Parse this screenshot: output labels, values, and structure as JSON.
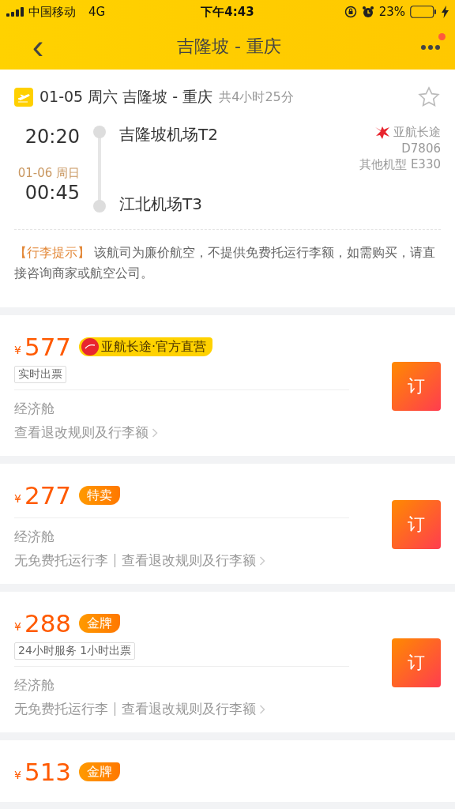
{
  "status_bar": {
    "carrier": "中国移动",
    "network": "4G",
    "time": "下午4:43",
    "battery": "23%"
  },
  "nav": {
    "back": "‹",
    "title": "吉隆坡 - 重庆",
    "notification": true
  },
  "flight": {
    "date_route": "01-05 周六 吉隆坡 - 重庆",
    "duration": "共4小时25分",
    "favorite": false,
    "depart": {
      "time": "20:20",
      "airport": "吉隆坡机场T2"
    },
    "arrive": {
      "date": "01-06 周日",
      "time": "00:45",
      "airport": "江北机场T3"
    },
    "airline": "亚航长途",
    "flight_no": "D7806",
    "aircraft": "其他机型 E330",
    "notice": {
      "label": "【行李提示】",
      "text": "该航司为廉价航空，不提供免费托运行李额，如需购买，请直接咨询商家或航空公司。"
    }
  },
  "fares": [
    {
      "currency": "¥",
      "price": "577",
      "badge": {
        "kind": "airline",
        "text": "亚航长途·官方直营"
      },
      "tag": "实时出票",
      "cabin": "经济舱",
      "rules": "查看退改规则及行李额",
      "book": "订"
    },
    {
      "currency": "¥",
      "price": "277",
      "badge": {
        "kind": "promo",
        "text": "特卖"
      },
      "cabin": "经济舱",
      "baggage": "无免费托运行李",
      "rules": "查看退改规则及行李额",
      "book": "订"
    },
    {
      "currency": "¥",
      "price": "288",
      "badge": {
        "kind": "promo",
        "text": "金牌"
      },
      "tag": "24小时服务 1小时出票",
      "cabin": "经济舱",
      "baggage": "无免费托运行李",
      "rules": "查看退改规则及行李额",
      "book": "订"
    },
    {
      "currency": "¥",
      "price": "513",
      "badge": {
        "kind": "promo",
        "text": "金牌"
      }
    }
  ]
}
